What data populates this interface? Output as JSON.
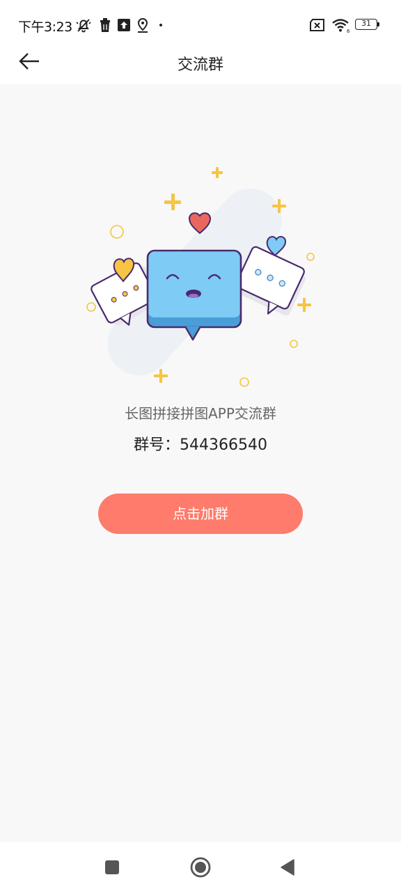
{
  "status_bar": {
    "time": "下午3:23",
    "battery": "31",
    "icons": [
      "mute-bell-icon",
      "trash-icon",
      "upload-icon",
      "location-icon",
      "dot-icon",
      "no-sim-icon",
      "wifi-icon",
      "battery-icon"
    ]
  },
  "header": {
    "title": "交流群",
    "back_icon": "arrow-left-icon"
  },
  "main": {
    "illustration": "chat-bubbles-illustration",
    "group_description": "长图拼接拼图APP交流群",
    "group_number": "群号：544366540",
    "join_button_label": "点击加群"
  },
  "nav_bar": {
    "icons": [
      "square-recent-icon",
      "circle-home-icon",
      "triangle-back-icon"
    ]
  },
  "colors": {
    "accent": "#ff7b6b",
    "bubble_blue": "#7ecbf5",
    "outline_purple": "#4a2a6e",
    "sparkle_yellow": "#f7c443",
    "heart_red": "#e8685e"
  }
}
